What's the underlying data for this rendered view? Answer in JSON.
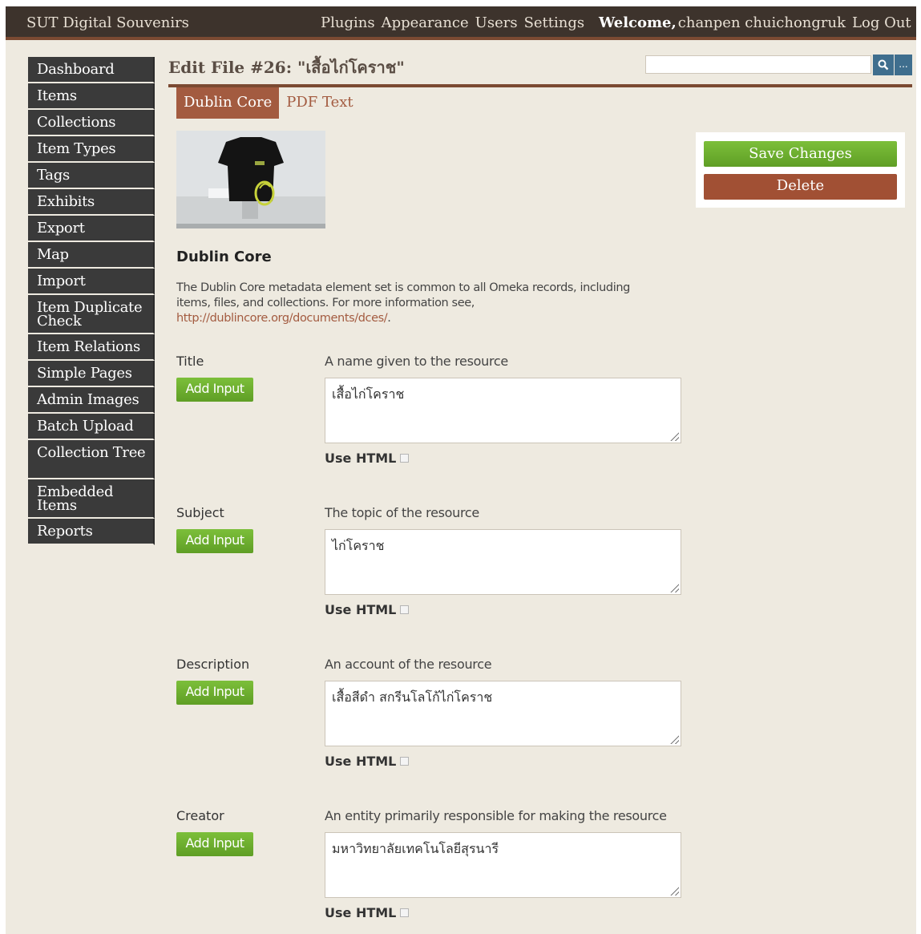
{
  "topbar": {
    "site_title": "SUT Digital Souvenirs",
    "nav": [
      "Plugins",
      "Appearance",
      "Users",
      "Settings"
    ],
    "welcome_label": "Welcome,",
    "user_name": "chanpen chuichongruk",
    "logout": "Log Out"
  },
  "sidebar": {
    "items": [
      {
        "label": "Dashboard"
      },
      {
        "label": "Items"
      },
      {
        "label": "Collections"
      },
      {
        "label": "Item Types"
      },
      {
        "label": "Tags"
      },
      {
        "label": "Exhibits"
      },
      {
        "label": "Export"
      },
      {
        "label": "Map"
      },
      {
        "label": "Import"
      },
      {
        "label": "Item Duplicate Check"
      },
      {
        "label": "Item Relations"
      },
      {
        "label": "Simple Pages"
      },
      {
        "label": "Admin Images"
      },
      {
        "label": "Batch Upload"
      },
      {
        "label": "Collection Tree"
      },
      {
        "label": "Embedded Items"
      },
      {
        "label": "Reports"
      }
    ]
  },
  "header": {
    "page_title": "Edit File #26: \"เสื้อไก่โคราช\"",
    "search_placeholder": "",
    "search_icon": "search-icon",
    "advanced_label": "..."
  },
  "tabs": [
    {
      "label": "Dublin Core"
    },
    {
      "label": "PDF Text"
    }
  ],
  "actions": {
    "save_label": "Save Changes",
    "delete_label": "Delete"
  },
  "section": {
    "heading": "Dublin Core",
    "description": "The Dublin Core metadata element set is common to all Omeka records, including items, files, and collections. For more information see,",
    "link_text": "http://dublincore.org/documents/dces/",
    "link_suffix": "."
  },
  "fields": [
    {
      "label": "Title",
      "hint": "A name given to the resource",
      "value": "เสื้อไก่โคราช",
      "add_input": "Add Input",
      "use_html": "Use HTML"
    },
    {
      "label": "Subject",
      "hint": "The topic of the resource",
      "value": "ไก่โคราช",
      "add_input": "Add Input",
      "use_html": "Use HTML"
    },
    {
      "label": "Description",
      "hint": "An account of the resource",
      "value": "เสื้อสีดำ สกรีนโลโก้ไก่โคราช",
      "add_input": "Add Input",
      "use_html": "Use HTML"
    },
    {
      "label": "Creator",
      "hint": "An entity primarily responsible for making the resource",
      "value": "มหาวิทยาลัยเทคโนโลยีสุรนารี",
      "add_input": "Add Input",
      "use_html": "Use HTML"
    }
  ],
  "colors": {
    "topbar_bg": "#3d332c",
    "accent_brown": "#a35b40",
    "green_button": "#6fae2f",
    "sidebar_bg": "#3a3a3a",
    "search_blue": "#3f6e8e"
  }
}
